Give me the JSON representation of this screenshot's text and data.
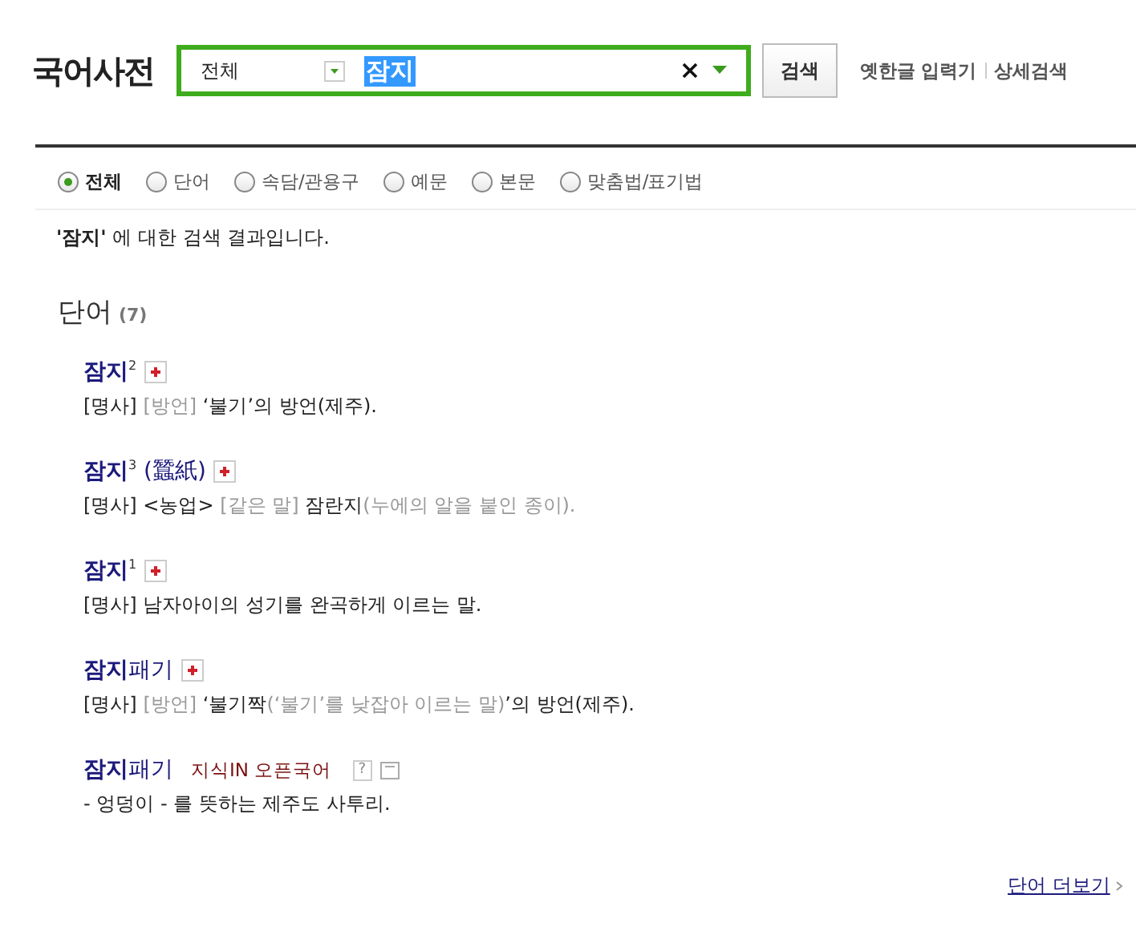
{
  "logo": "국어사전",
  "search": {
    "scope": "전체",
    "value": "잠지",
    "button": "검색"
  },
  "header_links": [
    "옛한글 입력기",
    "상세검색"
  ],
  "filters": [
    {
      "label": "전체",
      "selected": true
    },
    {
      "label": "단어",
      "selected": false
    },
    {
      "label": "속담/관용구",
      "selected": false
    },
    {
      "label": "예문",
      "selected": false
    },
    {
      "label": "본문",
      "selected": false
    },
    {
      "label": "맞춤법/표기법",
      "selected": false
    }
  ],
  "summary": "**'잠지'** 에 대한 검색 결과입니다.",
  "section": {
    "title": "단어",
    "count": "(7)"
  },
  "entries": [
    {
      "kind": "dict",
      "headword": "**잠지**$^{2}$",
      "definition": [
        {
          "text": "[명사] ",
          "kind": "plain"
        },
        {
          "text": "[방언]",
          "kind": "grey"
        },
        {
          "text": " ‘불기’의 방언(제주).",
          "kind": "plain"
        }
      ]
    },
    {
      "kind": "dict",
      "headword": "**잠지**$^{3}$ (蠶紙)",
      "definition": [
        {
          "text": "[명사] <농업> ",
          "kind": "plain"
        },
        {
          "text": "[같은 말]",
          "kind": "grey"
        },
        {
          "text": " 잠란지",
          "kind": "plain"
        },
        {
          "text": "(누에의 알을 붙인 종이).",
          "kind": "grey"
        }
      ]
    },
    {
      "kind": "dict",
      "headword": "**잠지**$^{1}$",
      "definition": [
        {
          "text": "[명사] 남자아이의 성기를 완곡하게 이르는 말.",
          "kind": "plain"
        }
      ]
    },
    {
      "kind": "dict",
      "headword": "**잠지**패기",
      "definition": [
        {
          "text": "[명사] ",
          "kind": "plain"
        },
        {
          "text": "[방언]",
          "kind": "grey"
        },
        {
          "text": " ‘불기짝",
          "kind": "plain"
        },
        {
          "text": "(‘불기’를 낮잡아 이르는 말)",
          "kind": "grey"
        },
        {
          "text": "’의 방언(제주).",
          "kind": "plain"
        }
      ]
    },
    {
      "kind": "open",
      "headword": "**잠지**패기",
      "source": "지식IN 오픈국어",
      "help": "?",
      "definition": [
        {
          "text": "- 엉덩이 -  를 뜻하는 제주도 사투리.",
          "kind": "plain"
        }
      ]
    }
  ],
  "more_link": "단어 더보기"
}
